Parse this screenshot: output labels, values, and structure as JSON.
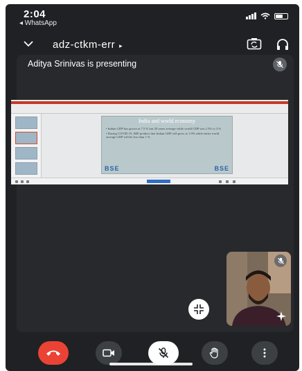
{
  "status_bar": {
    "time": "2:04",
    "back_app": "◂ WhatsApp"
  },
  "meeting": {
    "code": "adz-ctkm-err",
    "code_caret": "▸"
  },
  "presentation": {
    "presenting_label": "Aditya Srinivas is presenting"
  },
  "slide": {
    "title": "India and world economy",
    "bullets": [
      "Indian GDP has grown at 7.5 % last 20 years average while world GDP was 2.5% to 3 %",
      "During COVID 19, IMF predicts that Indian GDP will grow at 1.9% while entire world average GDP will be less than 1 %"
    ],
    "logo_left": "BSE",
    "logo_right": "BSE"
  },
  "icons": {
    "collapse": "chevron-down-icon",
    "camera_switch": "camera-switch-icon",
    "audio": "headphones-icon",
    "minimize": "minimize-icon",
    "end_call": "end-call-icon",
    "camera": "camera-icon",
    "mic": "mic-off-icon",
    "raise_hand": "raise-hand-icon",
    "more": "more-vertical-icon",
    "effects": "sparkle-icon"
  },
  "colors": {
    "background": "#202124",
    "end_call": "#ea4335",
    "control": "#3c4043"
  }
}
